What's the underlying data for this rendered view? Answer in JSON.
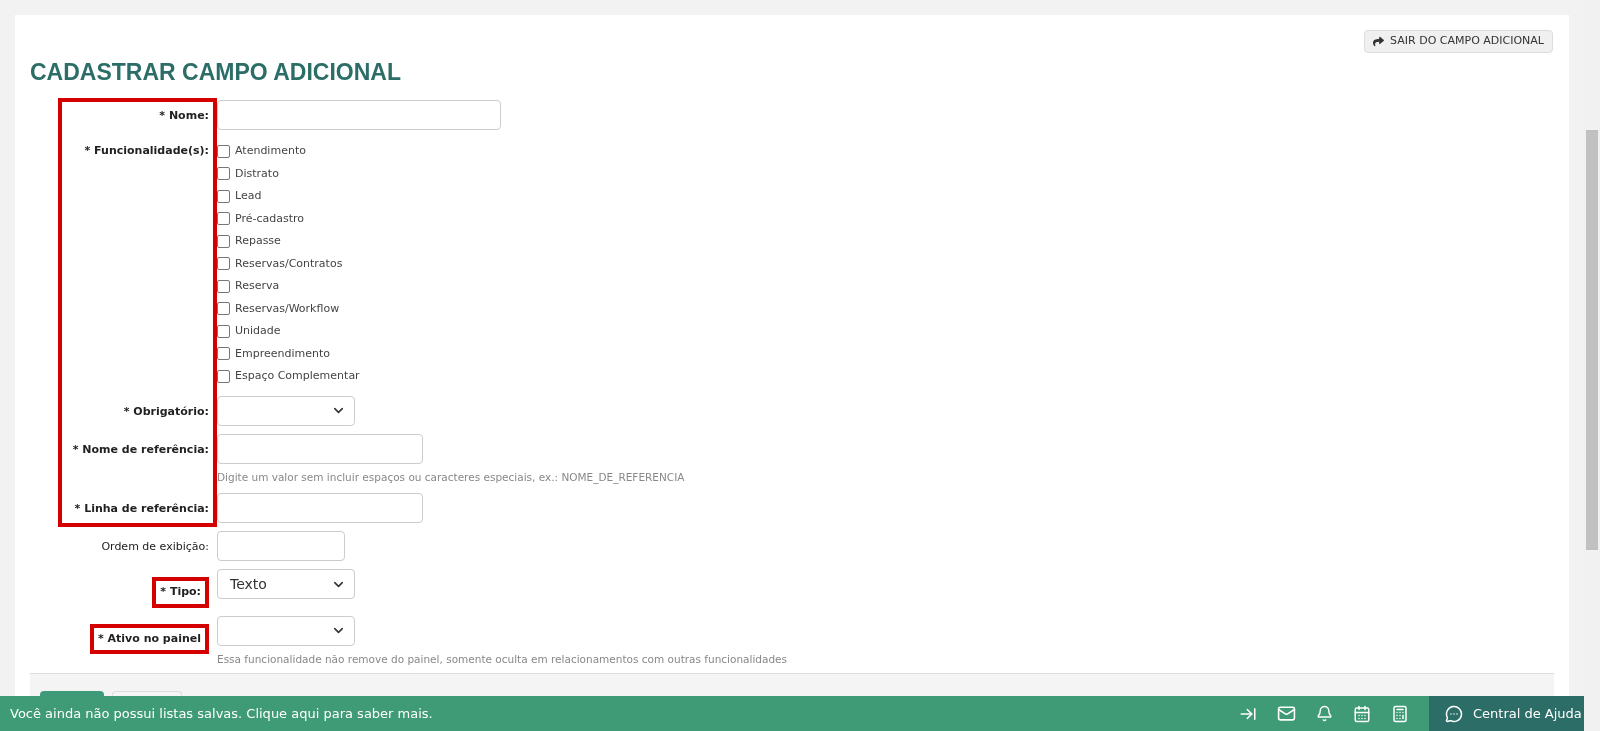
{
  "page": {
    "title": "CADASTRAR CAMPO ADICIONAL",
    "exit_button": "SAIR DO CAMPO ADICIONAL"
  },
  "form": {
    "groups": [
      {
        "highlighted": true,
        "fields": [
          {
            "kind": "text",
            "label": "* Nome:"
          },
          {
            "kind": "checkboxes",
            "label": "* Funcionalidade(s):",
            "options": [
              {
                "label": "Atendimento",
                "checked": false
              },
              {
                "label": "Distrato",
                "checked": false
              },
              {
                "label": "Lead",
                "checked": false
              },
              {
                "label": "Pré-cadastro",
                "checked": false
              },
              {
                "label": "Repasse",
                "checked": false
              },
              {
                "label": "Reservas/Contratos",
                "checked": false
              },
              {
                "label": "Reserva",
                "checked": false
              },
              {
                "label": "Reservas/Workflow",
                "checked": false
              },
              {
                "label": "Unidade",
                "checked": false
              },
              {
                "label": "Empreendimento",
                "checked": false
              },
              {
                "label": "Espaço Complementar",
                "checked": false
              }
            ]
          },
          {
            "kind": "select",
            "label": "* Obrigatório:"
          },
          {
            "kind": "text",
            "label": "* Nome de referência:",
            "hint": "Digite um valor sem incluir espaços ou caracteres especiais, ex.: NOME_DE_REFERENCIA"
          },
          {
            "kind": "text",
            "label": "* Linha de referência:"
          }
        ]
      },
      {
        "highlighted": false,
        "fields": [
          {
            "kind": "text",
            "label": "Ordem de exibição:",
            "required": false
          }
        ]
      },
      {
        "highlighted": true,
        "fields": [
          {
            "kind": "select",
            "label": "* Tipo:",
            "value": "Texto"
          }
        ]
      },
      {
        "highlighted": true,
        "fields": [
          {
            "kind": "select",
            "label": "* Ativo no painel",
            "hint": "Essa funcionalidade não remove do painel, somente oculta em relacionamentos com outras funcionalidades"
          }
        ]
      }
    ]
  },
  "bottom_bar": {
    "message": "Você ainda não possui listas salvas. Clique aqui para saber mais.",
    "help": "Central de Ajuda"
  }
}
